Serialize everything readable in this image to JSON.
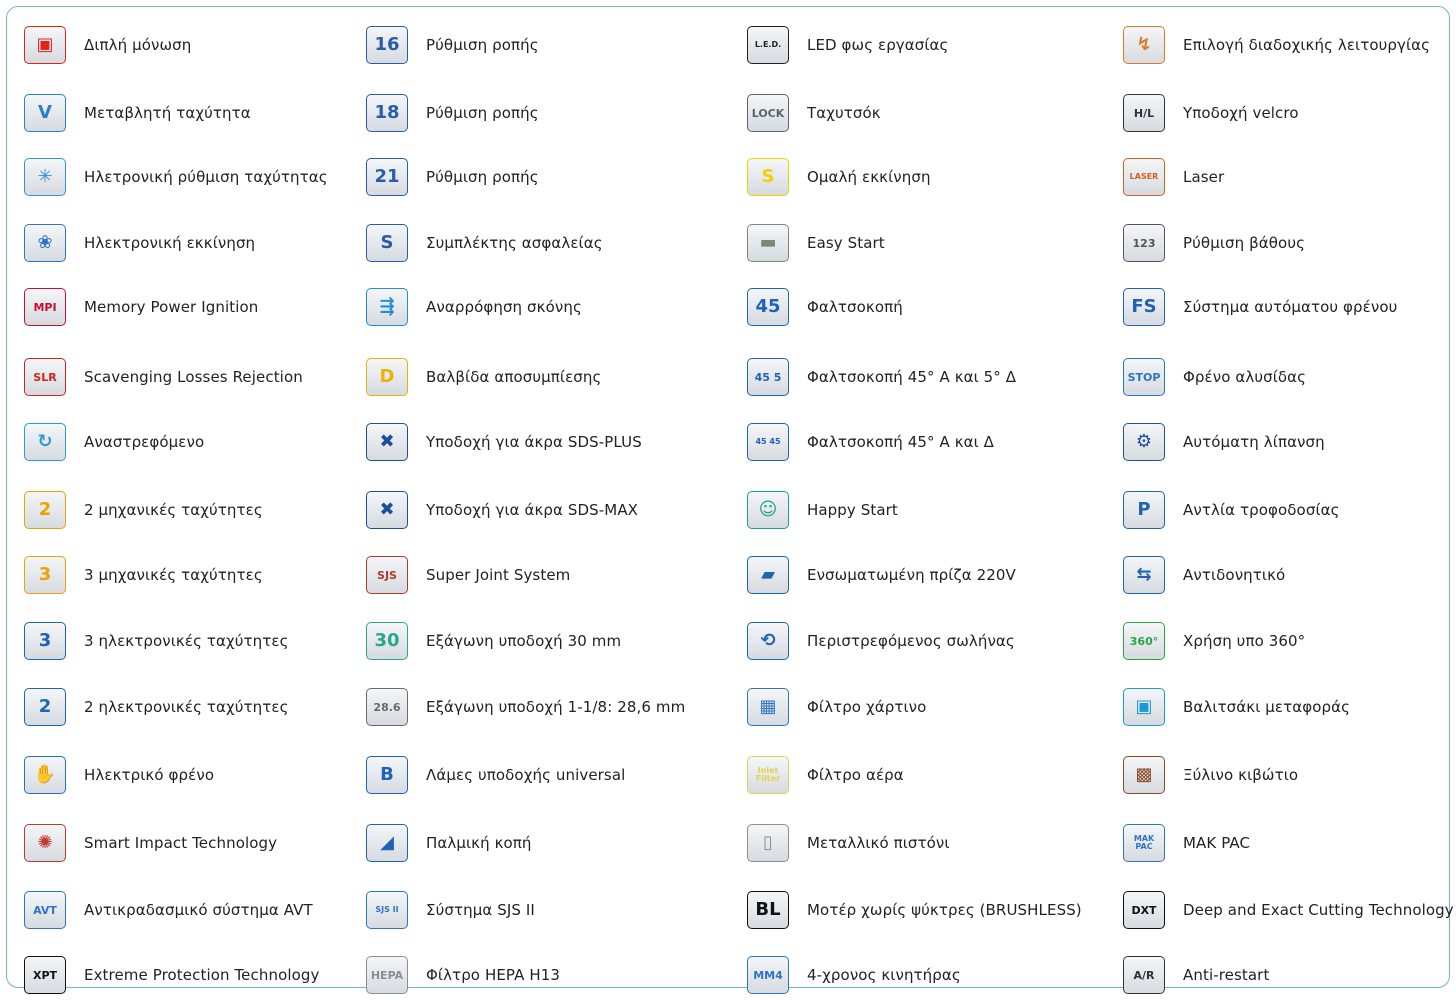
{
  "columns": [
    {
      "items": [
        {
          "label": "Διπλή μόνωση",
          "icon": "double-insulation-icon",
          "color": "#e2231a",
          "glyph": "▣"
        },
        {
          "label": "Μεταβλητή ταχύτητα",
          "icon": "variable-speed-icon",
          "color": "#2e7fc8",
          "glyph": "V"
        },
        {
          "label": "Ηλετρονική ρύθμιση ταχύτητας",
          "icon": "electronic-speed-icon",
          "color": "#3a8fd6",
          "glyph": "✳"
        },
        {
          "label": "Ηλεκτρονική εκκίνηση",
          "icon": "electronic-start-icon",
          "color": "#2f76c0",
          "glyph": "❀"
        },
        {
          "label": "Memory Power Ignition",
          "icon": "mpi-icon",
          "color": "#c8102e",
          "glyph": "MPI"
        },
        {
          "label": "Scavenging Losses Rejection",
          "icon": "slr-icon",
          "color": "#d3241c",
          "glyph": "SLR"
        },
        {
          "label": "Αναστρεφόμενο",
          "icon": "reversible-icon",
          "color": "#2e9ad2",
          "glyph": "↻"
        },
        {
          "label": "2 μηχανικές ταχύτητες",
          "icon": "two-mechanical-speeds-icon",
          "color": "#f0a000",
          "glyph": "2"
        },
        {
          "label": "3 μηχανικές ταχύτητες",
          "icon": "three-mechanical-speeds-icon",
          "color": "#f0a000",
          "glyph": "3"
        },
        {
          "label": "3 ηλεκτρονικές ταχύτητες",
          "icon": "three-electronic-speeds-icon",
          "color": "#1e63b5",
          "glyph": "3"
        },
        {
          "label": "2 ηλεκτρονικές ταχύτητες",
          "icon": "two-electronic-speeds-icon",
          "color": "#1e63b5",
          "glyph": "2"
        },
        {
          "label": "Ηλεκτρικό φρένο",
          "icon": "electric-brake-icon",
          "color": "#2a6fc0",
          "glyph": "✋"
        },
        {
          "label": "Smart Impact Technology",
          "icon": "smart-impact-icon",
          "color": "#c0392b",
          "glyph": "✺"
        },
        {
          "label": "Αντικραδασμικό σύστημα AVT",
          "icon": "avt-icon",
          "color": "#2e74c4",
          "glyph": "AVT"
        },
        {
          "label": "Extreme Protection Technology",
          "icon": "xpt-icon",
          "color": "#111111",
          "glyph": "XPT"
        }
      ]
    },
    {
      "items": [
        {
          "label": "Ρύθμιση ροπής",
          "icon": "torque-16-icon",
          "color": "#2a5da8",
          "glyph": "16"
        },
        {
          "label": "Ρύθμιση ροπής",
          "icon": "torque-18-icon",
          "color": "#2a5da8",
          "glyph": "18"
        },
        {
          "label": "Ρύθμιση ροπής",
          "icon": "torque-21-icon",
          "color": "#2a5da8",
          "glyph": "21"
        },
        {
          "label": "Συμπλέκτης ασφαλείας",
          "icon": "safety-clutch-icon",
          "color": "#2a5da8",
          "glyph": "S"
        },
        {
          "label": "Αναρρόφηση σκόνης",
          "icon": "dust-extraction-icon",
          "color": "#1f8fd8",
          "glyph": "⇶"
        },
        {
          "label": "Βαλβίδα αποσυμπίεσης",
          "icon": "decompression-valve-icon",
          "color": "#e8b400",
          "glyph": "D"
        },
        {
          "label": "Υποδοχή για άκρα SDS-PLUS",
          "icon": "sds-plus-icon",
          "color": "#1b4f9c",
          "glyph": "✖"
        },
        {
          "label": "Υποδοχή για άκρα SDS-MAX",
          "icon": "sds-max-icon",
          "color": "#1b4f9c",
          "glyph": "✖"
        },
        {
          "label": "Super Joint System",
          "icon": "sjs-icon",
          "color": "#b03a2e",
          "glyph": "SJS"
        },
        {
          "label": "Εξάγωνη υποδοχή 30 mm",
          "icon": "hex-30-icon",
          "color": "#2aa68a",
          "glyph": "30"
        },
        {
          "label": "Εξάγωνη υποδοχή 1-1/8: 28,6 mm",
          "icon": "hex-28-icon",
          "color": "#6a6a6a",
          "glyph": "28.6"
        },
        {
          "label": "Λάμες υποδοχής universal",
          "icon": "universal-blades-icon",
          "color": "#1e63b5",
          "glyph": "B"
        },
        {
          "label": "Παλμική κοπή",
          "icon": "pulse-cut-icon",
          "color": "#1e63b5",
          "glyph": "◢"
        },
        {
          "label": "Σύστημα SJS II",
          "icon": "sjs-ii-icon",
          "color": "#2e74c4",
          "glyph": "SJS II"
        },
        {
          "label": "Φίλτρο HEPA H13",
          "icon": "hepa-icon",
          "color": "#8a8f96",
          "glyph": "HEPA"
        }
      ]
    },
    {
      "items": [
        {
          "label": "LED φως εργασίας",
          "icon": "led-light-icon",
          "color": "#222222",
          "glyph": "L.E.D."
        },
        {
          "label": "Ταχυτσόκ",
          "icon": "keyless-chuck-icon",
          "color": "#5a6470",
          "glyph": "LOCK"
        },
        {
          "label": "Ομαλή εκκίνηση",
          "icon": "soft-start-icon",
          "color": "#f2d100",
          "glyph": "S"
        },
        {
          "label": "Easy Start",
          "icon": "easy-start-icon",
          "color": "#7a8a7a",
          "glyph": "▬"
        },
        {
          "label": "Φαλτσοκοπή",
          "icon": "bevel-cut-icon",
          "color": "#1e63b5",
          "glyph": "45"
        },
        {
          "label": "Φαλτσοκοπή 45° Α και 5° Δ",
          "icon": "bevel-45-5-icon",
          "color": "#1e63b5",
          "glyph": "45 5"
        },
        {
          "label": "Φαλτσοκοπή 45° Α και Δ",
          "icon": "bevel-45-45-icon",
          "color": "#1e63b5",
          "glyph": "45 45"
        },
        {
          "label": "Happy Start",
          "icon": "happy-start-icon",
          "color": "#1aa38a",
          "glyph": "☺"
        },
        {
          "label": "Ενσωματωμένη πρίζα 220V",
          "icon": "built-in-socket-icon",
          "color": "#1e63b5",
          "glyph": "▰"
        },
        {
          "label": "Περιστρεφόμενος σωλήνας",
          "icon": "rotating-hose-icon",
          "color": "#1e63b5",
          "glyph": "⟲"
        },
        {
          "label": "Φίλτρο χάρτινο",
          "icon": "paper-filter-icon",
          "color": "#2e74c4",
          "glyph": "▦"
        },
        {
          "label": "Φίλτρο αέρα",
          "icon": "air-filter-icon",
          "color": "#e8d24a",
          "glyph": "Inlet Filter"
        },
        {
          "label": "Μεταλλικό πιστόνι",
          "icon": "metal-piston-icon",
          "color": "#8a8f96",
          "glyph": "▯"
        },
        {
          "label": "Μοτέρ χωρίς ψύκτρες (BRUSHLESS)",
          "icon": "brushless-icon",
          "color": "#111111",
          "glyph": "BL"
        },
        {
          "label": "4-χρονος κινητήρας",
          "icon": "four-stroke-icon",
          "color": "#2e74c4",
          "glyph": "MM4"
        }
      ]
    },
    {
      "items": [
        {
          "label": "Επιλογή διαδοχικής λειτουργίας",
          "icon": "sequential-mode-icon",
          "color": "#e07a2a",
          "glyph": "↯"
        },
        {
          "label": "Υποδοχή velcro",
          "icon": "velcro-icon",
          "color": "#333333",
          "glyph": "H/L"
        },
        {
          "label": "Laser",
          "icon": "laser-icon",
          "color": "#d4601a",
          "glyph": "LASER"
        },
        {
          "label": "Ρύθμιση βάθους",
          "icon": "depth-adjust-icon",
          "color": "#555555",
          "glyph": "123"
        },
        {
          "label": "Σύστημα αυτόματου φρένου",
          "icon": "auto-brake-icon",
          "color": "#1e63b5",
          "glyph": "FS"
        },
        {
          "label": "Φρένο αλυσίδας",
          "icon": "chain-brake-icon",
          "color": "#2e74c4",
          "glyph": "STOP"
        },
        {
          "label": "Αυτόματη λίπανση",
          "icon": "auto-lubrication-icon",
          "color": "#1e4fa0",
          "glyph": "⚙"
        },
        {
          "label": "Αντλία τροφοδοσίας",
          "icon": "feed-pump-icon",
          "color": "#1e63b5",
          "glyph": "P"
        },
        {
          "label": "Αντιδονητικό",
          "icon": "anti-vibration-icon",
          "color": "#1e63b5",
          "glyph": "⇆"
        },
        {
          "label": "Χρήση υπο 360°",
          "icon": "use-360-icon",
          "color": "#2aa640",
          "glyph": "360°"
        },
        {
          "label": "Βαλιτσάκι μεταφοράς",
          "icon": "carry-case-icon",
          "color": "#1a9ad6",
          "glyph": "▣"
        },
        {
          "label": "Ξύλινο κιβώτιο",
          "icon": "wooden-box-icon",
          "color": "#8a4a2a",
          "glyph": "▩"
        },
        {
          "label": "MAK PAC",
          "icon": "makpac-icon",
          "color": "#2e74c4",
          "glyph": "MAK PAC"
        },
        {
          "label": "Deep and Exact Cutting Technology",
          "icon": "dxt-icon",
          "color": "#111111",
          "glyph": "DXT"
        },
        {
          "label": "Anti-restart",
          "icon": "anti-restart-icon",
          "color": "#333333",
          "glyph": "A/R"
        }
      ]
    }
  ]
}
